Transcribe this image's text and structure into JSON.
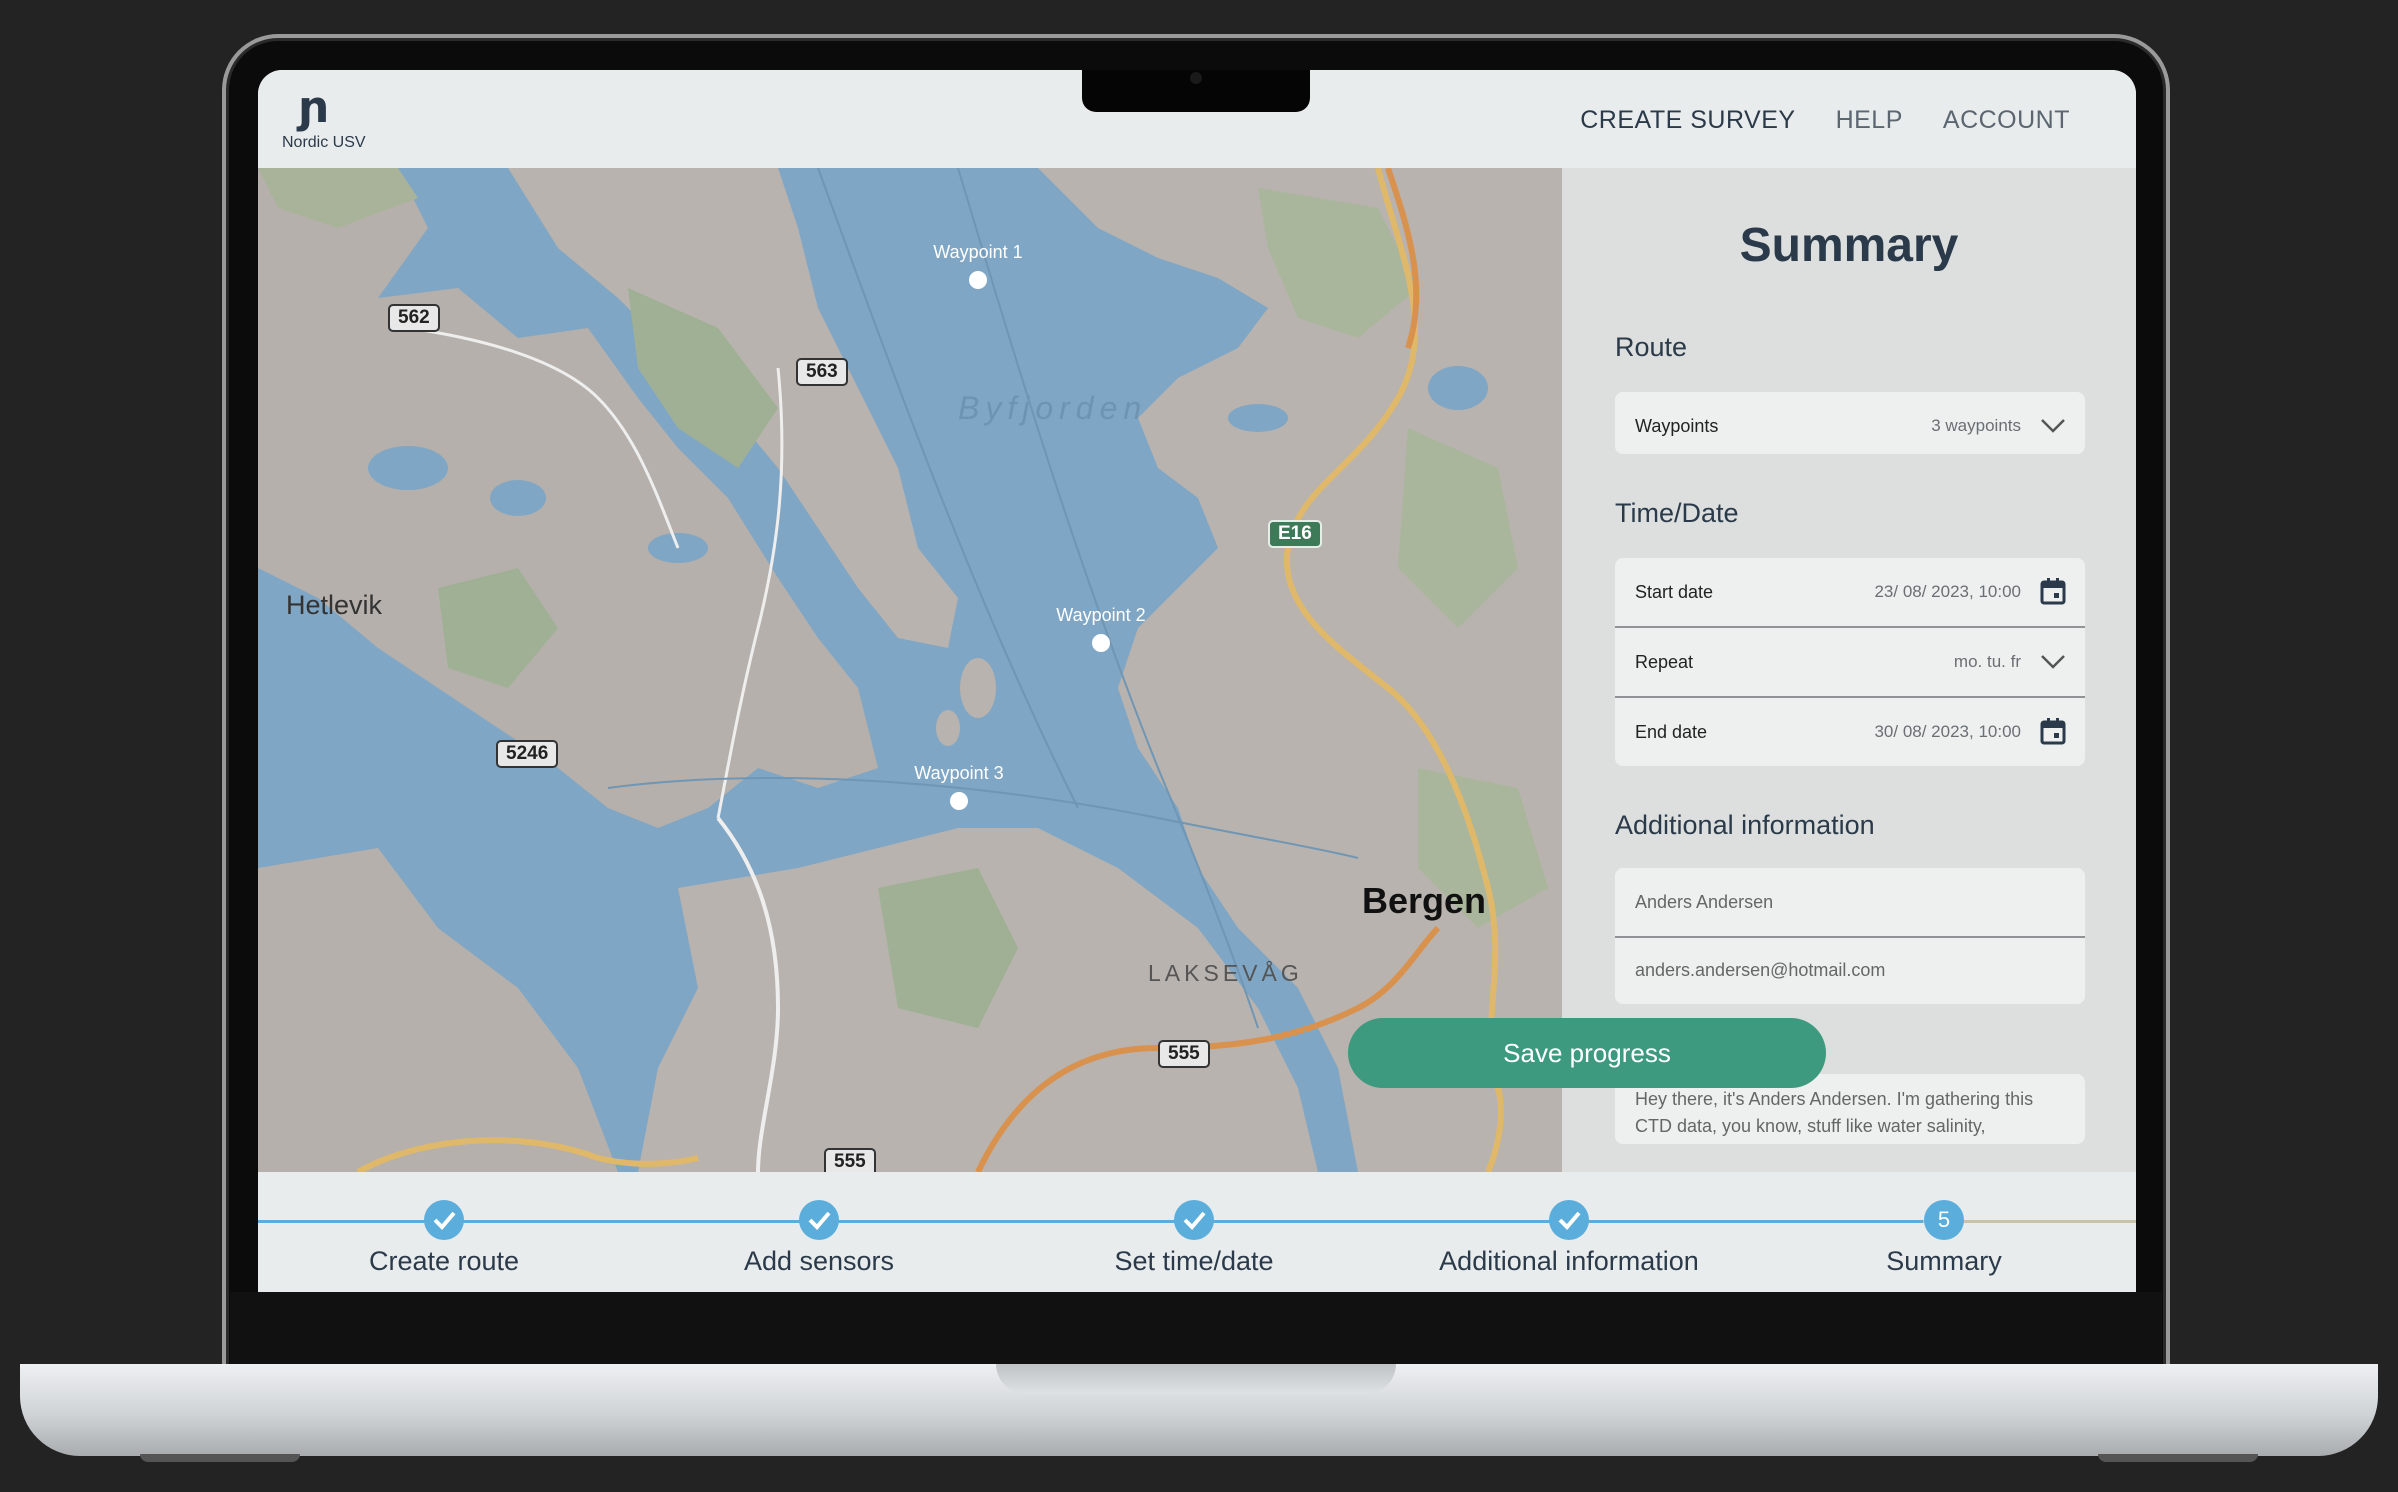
{
  "app": {
    "logo_text": "Nordic USV"
  },
  "nav": {
    "items": [
      "CREATE SURVEY",
      "HELP",
      "ACCOUNT"
    ]
  },
  "map": {
    "water_label": "Byfjorden",
    "places": {
      "hetlevik": "Hetlevik",
      "bergen": "Bergen",
      "laksevag": "LAKSEVÅG"
    },
    "road_shields": [
      "562",
      "563",
      "E16",
      "5246",
      "555",
      "555"
    ],
    "waypoints": [
      "Waypoint 1",
      "Waypoint 2",
      "Waypoint 3"
    ]
  },
  "summary": {
    "title": "Summary",
    "route": {
      "heading": "Route",
      "waypoints_label": "Waypoints",
      "waypoints_value": "3 waypoints"
    },
    "time": {
      "heading": "Time/Date",
      "start_label": "Start date",
      "start_value": "23/ 08/ 2023, 10:00",
      "repeat_label": "Repeat",
      "repeat_value": "mo. tu. fr",
      "end_label": "End date",
      "end_value": "30/ 08/ 2023, 10:00"
    },
    "additional": {
      "heading": "Additional information",
      "name": "Anders Andersen",
      "email": "anders.andersen@hotmail.com",
      "message": "Hey there, it's Anders Andersen. I'm gathering this CTD data, you know, stuff like water salinity,"
    },
    "save_label": "Save progress"
  },
  "stepper": {
    "steps": [
      "Create route",
      "Add sensors",
      "Set time/date",
      "Additional information",
      "Summary"
    ],
    "current_step_number": "5",
    "colors": {
      "accent": "#5baedc",
      "save": "#3e9a7f"
    }
  }
}
